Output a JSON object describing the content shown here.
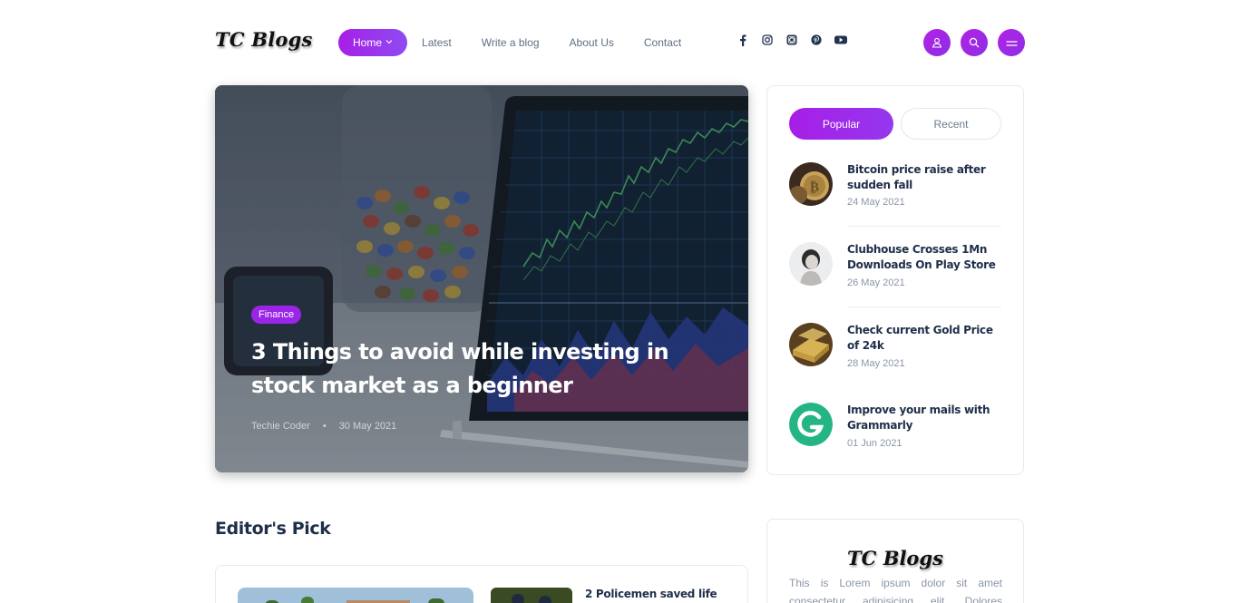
{
  "brand": {
    "logo": "TC Blogs",
    "accent": "#a71ee6"
  },
  "nav": {
    "items": [
      {
        "label": "Home",
        "active": true
      },
      {
        "label": "Latest"
      },
      {
        "label": "Write a blog"
      },
      {
        "label": "About Us"
      },
      {
        "label": "Contact"
      }
    ]
  },
  "social": [
    "facebook-icon",
    "instagram-icon",
    "instagram-alt-icon",
    "pinterest-icon",
    "youtube-icon"
  ],
  "header_buttons": [
    "user-icon",
    "search-icon",
    "menu-icon"
  ],
  "hero": {
    "category": "Finance",
    "title": "3 Things to avoid while investing in stock market as a beginner",
    "author": "Techie Coder",
    "separator": "•",
    "date": "30 May 2021"
  },
  "sidebar": {
    "tabs": {
      "popular": "Popular",
      "recent": "Recent"
    },
    "posts": [
      {
        "title": "Bitcoin price raise after sudden fall",
        "date": "24 May 2021",
        "icon": "bitcoin-thumbnail"
      },
      {
        "title": "Clubhouse Crosses 1Mn Downloads On Play Store",
        "date": "26 May 2021",
        "icon": "clubhouse-thumbnail"
      },
      {
        "title": "Check current Gold Price of 24k",
        "date": "28 May 2021",
        "icon": "gold-thumbnail"
      },
      {
        "title": "Improve your mails with Grammarly",
        "date": "01 Jun 2021",
        "icon": "grammarly-thumbnail"
      }
    ]
  },
  "editors_pick": {
    "heading": "Editor's Pick",
    "posts": [
      {
        "title": "2 Policemen saved life"
      }
    ]
  },
  "about": {
    "logo": "TC Blogs",
    "text": "This is Lorem ipsum dolor sit amet consectetur adipisicing elit. Dolores"
  }
}
